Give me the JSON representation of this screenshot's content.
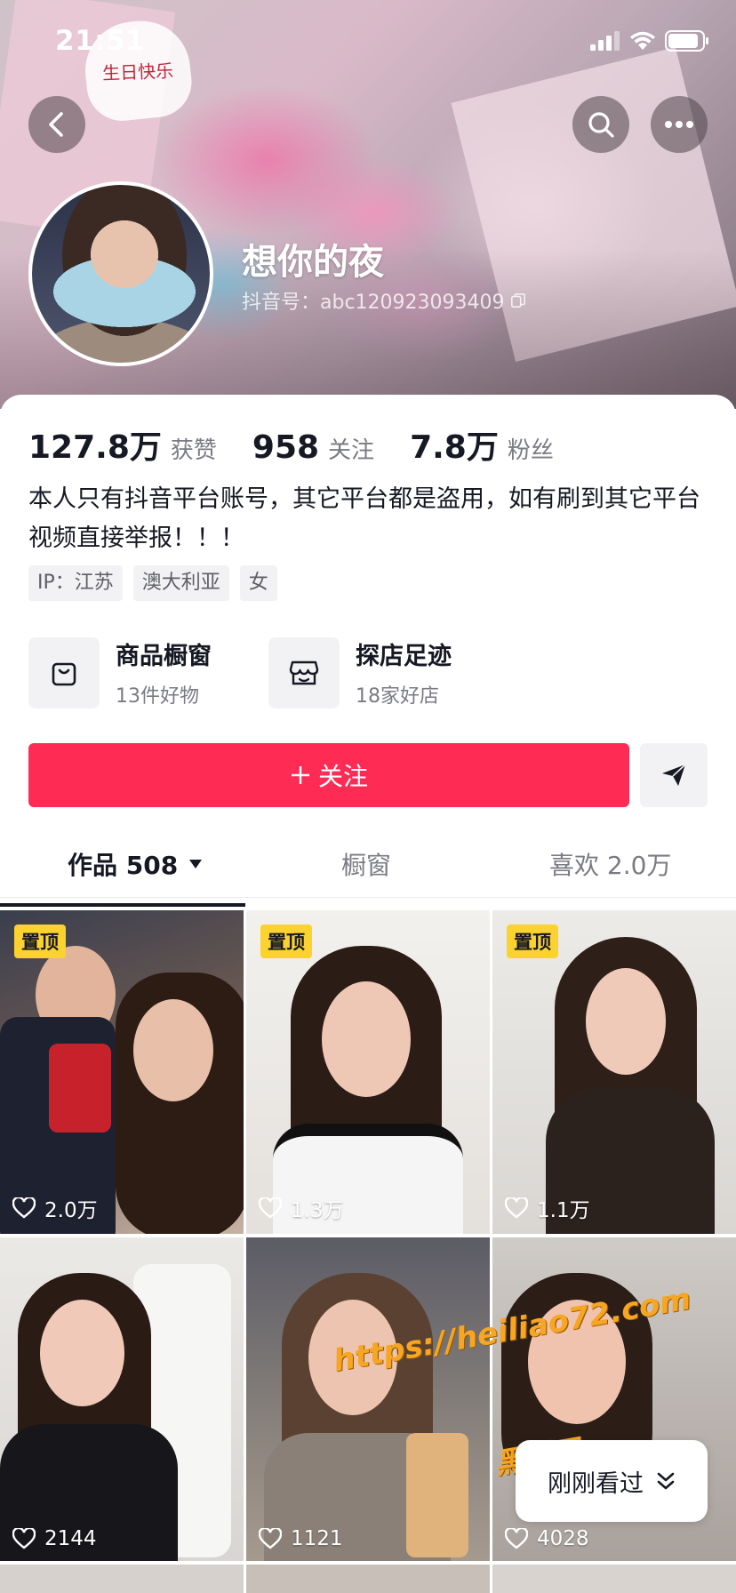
{
  "status_bar": {
    "time": "21:51"
  },
  "banner": {
    "card_text": "生日快乐"
  },
  "profile": {
    "nickname": "想你的夜",
    "douyin_id": "抖音号：abc120923093409"
  },
  "stats": [
    {
      "value": "127.8万",
      "label": "获赞"
    },
    {
      "value": "958",
      "label": "关注"
    },
    {
      "value": "7.8万",
      "label": "粉丝"
    }
  ],
  "bio": "本人只有抖音平台账号，其它平台都是盗用，如有刷到其它平台视频直接举报！！！",
  "tags": [
    "IP：江苏",
    "澳大利亚",
    "女"
  ],
  "shops": [
    {
      "title": "商品橱窗",
      "subtitle": "13件好物",
      "icon": "bag-icon"
    },
    {
      "title": "探店足迹",
      "subtitle": "18家好店",
      "icon": "store-icon"
    }
  ],
  "actions": {
    "follow_label": "关注",
    "share_icon": "send-icon"
  },
  "tabs": [
    {
      "label": "作品 508"
    },
    {
      "label": "橱窗"
    },
    {
      "label": "喜欢 2.0万"
    }
  ],
  "videos": [
    {
      "pinned": "置顶",
      "likes": "2.0万"
    },
    {
      "pinned": "置顶",
      "likes": "1.3万"
    },
    {
      "pinned": "置顶",
      "likes": "1.1万"
    },
    {
      "pinned": "",
      "likes": "2144"
    },
    {
      "pinned": "",
      "likes": "1121"
    },
    {
      "pinned": "",
      "likes": "4028"
    }
  ],
  "watermark": {
    "url": "https://heiliao72.com",
    "name": "黑料网"
  },
  "recent_button": {
    "label": "刚刚看过"
  },
  "colors": {
    "accent": "#fe2c55",
    "pin": "#fbd22e",
    "text": "#161823",
    "secondary": "#7a7b83"
  }
}
